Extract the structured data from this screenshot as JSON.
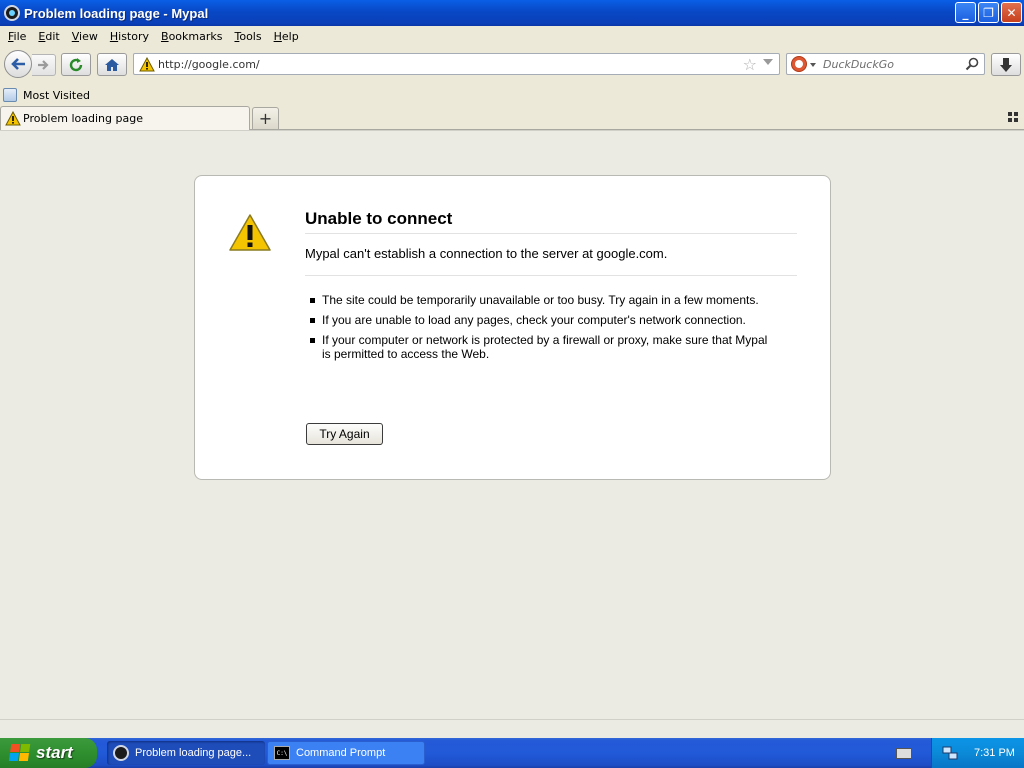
{
  "window": {
    "title": "Problem loading page - Mypal",
    "minimize_label": "_",
    "maximize_label": "❐",
    "close_label": "✕"
  },
  "menu": [
    "File",
    "Edit",
    "View",
    "History",
    "Bookmarks",
    "Tools",
    "Help"
  ],
  "navbar": {
    "url": "http://google.com/",
    "search_placeholder": "DuckDuckGo",
    "star_glyph": "☆"
  },
  "bookmarks": {
    "items": [
      {
        "label": "Most Visited"
      }
    ]
  },
  "tabs": {
    "active_label": "Problem loading page",
    "new_tab_label": "+"
  },
  "error": {
    "title": "Unable to connect",
    "description": "Mypal can't establish a connection to the server at google.com.",
    "items": [
      "The site could be temporarily unavailable or too busy. Try again in a few moments.",
      "If you are unable to load any pages, check your computer's network connection.",
      "If your computer or network is protected by a firewall or proxy, make sure that Mypal is permitted to access the Web."
    ],
    "button_label": "Try Again"
  },
  "taskbar": {
    "start_label": "start",
    "tasks": [
      {
        "label": "Problem loading page...",
        "icon": "mypal-icon",
        "active": true
      },
      {
        "label": "Command Prompt",
        "icon": "cmd-icon",
        "active": false
      }
    ],
    "cmd_icon_text": "C:\\",
    "clock": "7:31 PM"
  },
  "colors": {
    "titlebar": "#0848c5",
    "taskbar": "#215ad8",
    "start": "#2f8f2f",
    "tray": "#0b8ad8",
    "content_bg": "#ecebe3",
    "warning_yellow": "#f5c400"
  }
}
